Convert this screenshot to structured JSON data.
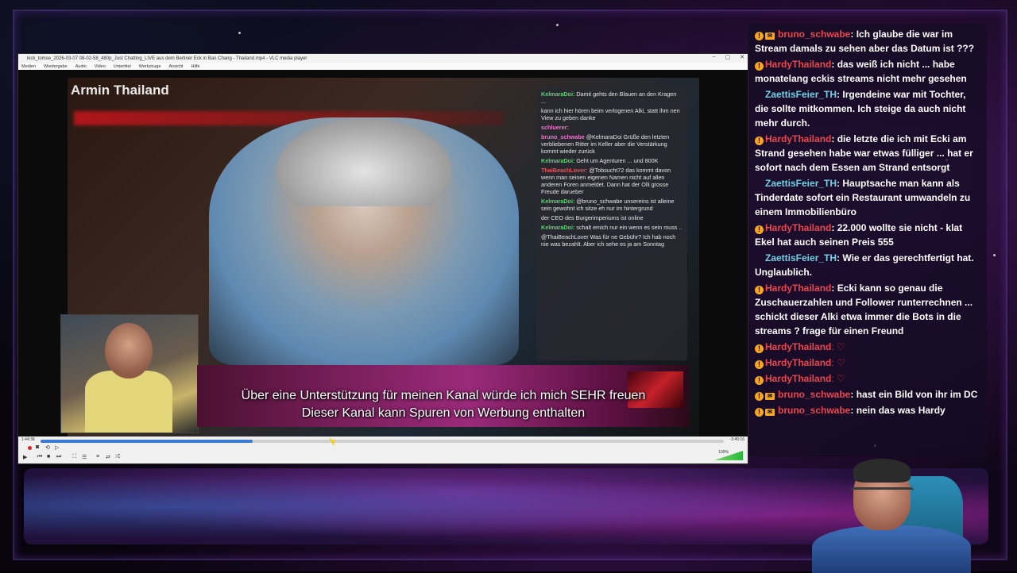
{
  "vlc": {
    "title": "kick_tomse_2026-03-07 08-02-58_480p_Just Chatting_LIVE aus dem Berliner Eck in Ban Chang - Thailand.mp4 - VLC media player",
    "menu": [
      "Medien",
      "Wiedergabe",
      "Audio",
      "Video",
      "Untertitel",
      "Werkzeuge",
      "Ansicht",
      "Hilfe"
    ],
    "window_controls": [
      "–",
      "▢",
      "✕"
    ],
    "time_elapsed": "1:44:38",
    "time_total": "-3:45:16",
    "seek_progress": 0.31,
    "volume_label": "100%"
  },
  "video": {
    "streamer_name": "Armin Thailand",
    "banner_line1": "Über eine Unterstützung für meinen Kanal würde ich mich SEHR freuen",
    "banner_line2": "Dieser Kanal kann Spuren von Werbung enthalten",
    "overlay_chat": [
      {
        "user": "KelmaraDoi:",
        "text": "Damit gehts den Blauen an den Kragen ...",
        "color": "green"
      },
      {
        "user": "",
        "text": "kann ich hier hören beim verlogenen Alki, statt ihm nen View zu geben  danke",
        "color": "pink"
      },
      {
        "user": "schluerer:",
        "text": "",
        "color": "pink"
      },
      {
        "user": "bruno_schwabe",
        "text": "@KelmaraDoi Grüße den letzten verbliebenen Ritter im Keller aber die Verstärkung kommt wieder zurück",
        "color": "pink"
      },
      {
        "user": "KelmaraDoi:",
        "text": "Geht um Agenturen ... und 800K",
        "color": "green"
      },
      {
        "user": "ThaiBeachLover:",
        "text": "@Tobsucht72 das kommt davon wenn man seinen eigenen Namen nicht auf allen anderen Foren anmeldet. Dann hat der Olli grosse Freude darueber",
        "color": "red"
      },
      {
        "user": "KelmaraDoi:",
        "text": "@bruno_schwabe unsereins ist alleine sein gewohnt ich sitze eh nur im hintergrund",
        "color": "green"
      },
      {
        "user": "",
        "text": "der CEO des Burgerimperiums ist online",
        "color": "pink"
      },
      {
        "user": "KelmaraDoi:",
        "text": "schalt emich nur ein wenn es sein muss ..",
        "color": "green"
      },
      {
        "user": "",
        "text": "@ThaiBeachLover Was für ne Gebühr? Ich hab noch nie was bezahlt. Aber ich sehe es ja am Sonntag",
        "color": "red"
      }
    ]
  },
  "chat": {
    "messages": [
      {
        "user": "bruno_schwabe",
        "type": "bruno",
        "text": ": Ich glaube die war im Stream damals zu sehen aber das Datum ist ???"
      },
      {
        "user": "HardyThailand",
        "type": "hardy",
        "text": ": das weiß ich nicht ... habe monatelang eckis streams nicht mehr gesehen"
      },
      {
        "user": "ZaettisFeier_TH",
        "type": "zaet",
        "text": ": Irgendeine war mit Tochter, die sollte mitkommen. Ich steige da auch nicht mehr durch."
      },
      {
        "user": "HardyThailand",
        "type": "hardy",
        "text": ": die letzte die ich mit Ecki am Strand gesehen habe war etwas fülliger ... hat er sofort nach dem Essen am Strand entsorgt"
      },
      {
        "user": "ZaettisFeier_TH",
        "type": "zaet",
        "text": ": Hauptsache man kann als Tinderdate sofort ein Restaurant umwandeln zu einem Immobilienbüro"
      },
      {
        "user": "HardyThailand",
        "type": "hardy",
        "text": ": 22.000 wollte sie nicht - klat Ekel hat auch seinen Preis 555"
      },
      {
        "user": "ZaettisFeier_TH",
        "type": "zaet",
        "text": ": Wie er das gerechtfertigt hat. Unglaublich."
      },
      {
        "user": "HardyThailand",
        "type": "hardy",
        "text": ": Ecki kann so genau die Zuschauerzahlen und Follower runterrechnen ... schickt dieser Alki etwa immer die Bots in die streams ? frage für einen Freund"
      },
      {
        "user": "HardyThailand",
        "type": "hardy",
        "text": ": ♡"
      },
      {
        "user": "HardyThailand",
        "type": "hardy",
        "text": ": ♡"
      },
      {
        "user": "HardyThailand",
        "type": "hardy",
        "text": ": ♡"
      },
      {
        "user": "bruno_schwabe",
        "type": "bruno",
        "text": ": hast ein Bild von ihr im DC"
      },
      {
        "user": "bruno_schwabe",
        "type": "bruno",
        "text": ": nein das was Hardy"
      }
    ]
  },
  "colors": {
    "accent_red": "#e8474f",
    "accent_cyan": "#6fd3e6",
    "badge": "#f5a623",
    "seek": "#3a7bd5"
  }
}
